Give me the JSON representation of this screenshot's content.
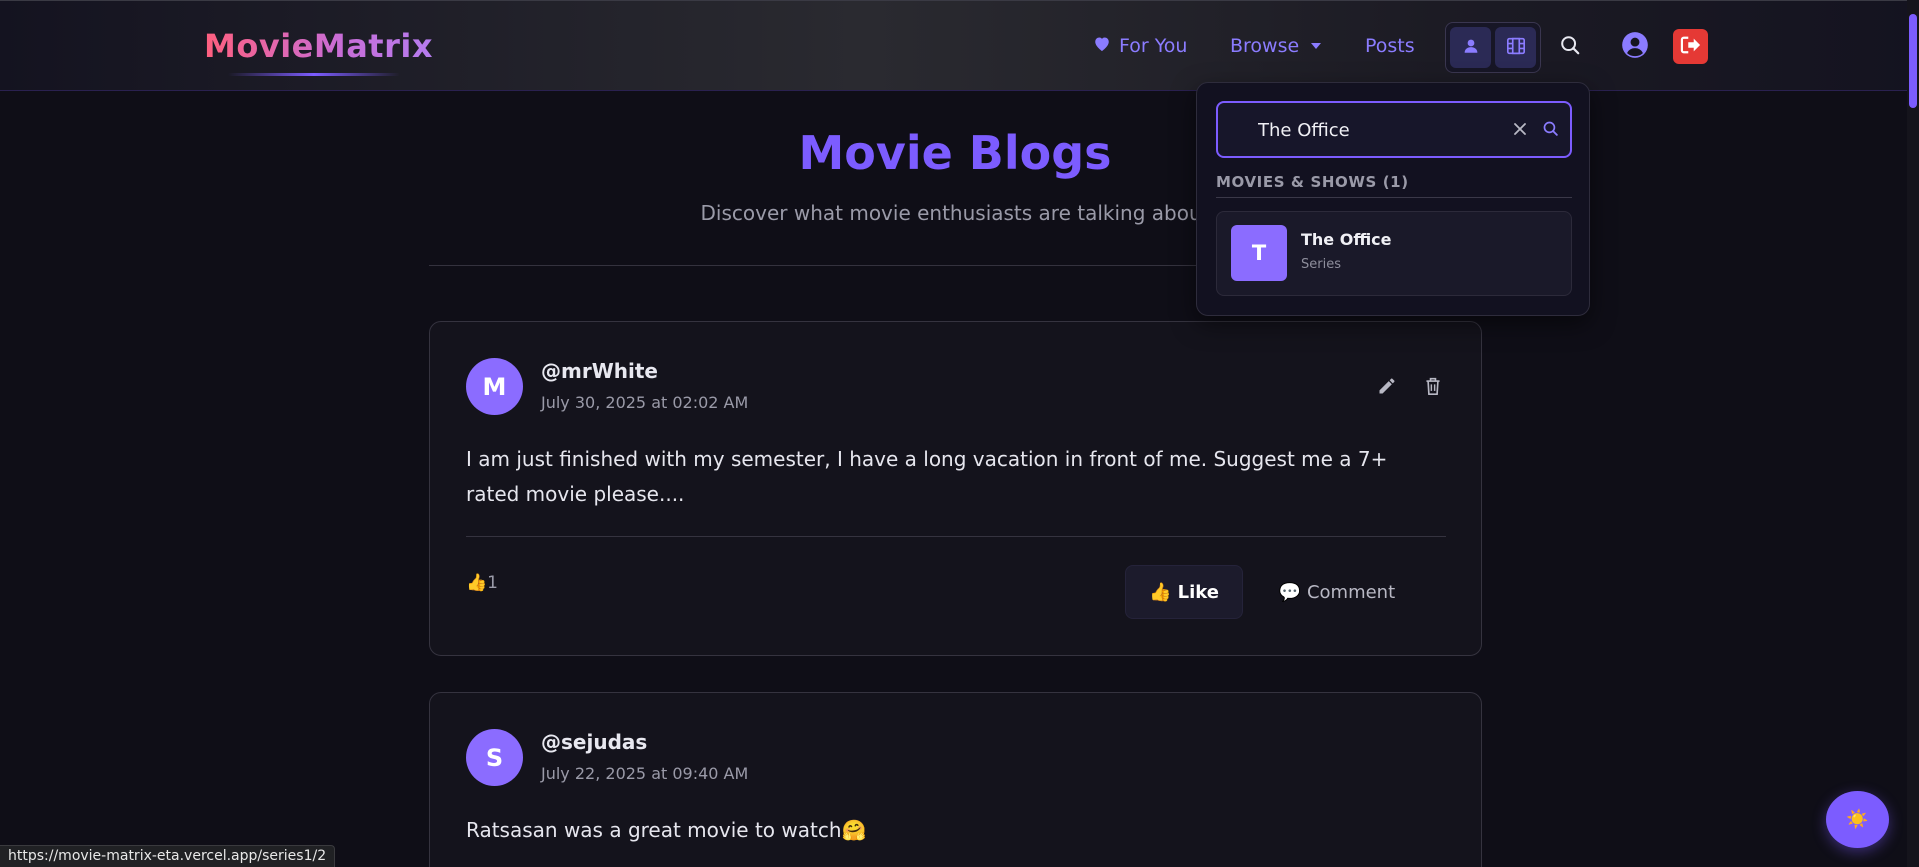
{
  "app": {
    "logo": "MovieMatrix"
  },
  "nav": {
    "for_you": "For You",
    "browse": "Browse",
    "posts": "Posts",
    "icons": [
      "heart-icon",
      "user-icon",
      "film-icon",
      "search-icon",
      "account-circle-icon",
      "logout-icon"
    ]
  },
  "page": {
    "title": "Movie Blogs",
    "subtitle": "Discover what movie enthusiasts are talking about"
  },
  "posts": [
    {
      "avatar_letter": "M",
      "username": "@mrWhite",
      "date": "July 30, 2025 at 02:02 AM",
      "text": "I am just finished with my semester, I have a long vacation in front of me. Suggest me a 7+ rated movie please....",
      "like_count": "👍1",
      "like_label": "👍 Like",
      "comment_label": "💬 Comment"
    },
    {
      "avatar_letter": "S",
      "username": "@sejudas",
      "date": "July 22, 2025 at 09:40 AM",
      "text": "Ratsasan was a great movie to watch🤗"
    }
  ],
  "search": {
    "value": "The Office",
    "section_label": "MOVIES & SHOWS (1)",
    "results": [
      {
        "thumb_letter": "T",
        "title": "The Office",
        "type": "Series"
      }
    ]
  },
  "status_bar": {
    "url": "https://movie-matrix-eta.vercel.app/series1/2"
  },
  "theme_toggle": {
    "icon": "☀️"
  },
  "colors": {
    "accent": "#7c5cff",
    "background": "#0f0e17",
    "logout": "#e53935"
  }
}
